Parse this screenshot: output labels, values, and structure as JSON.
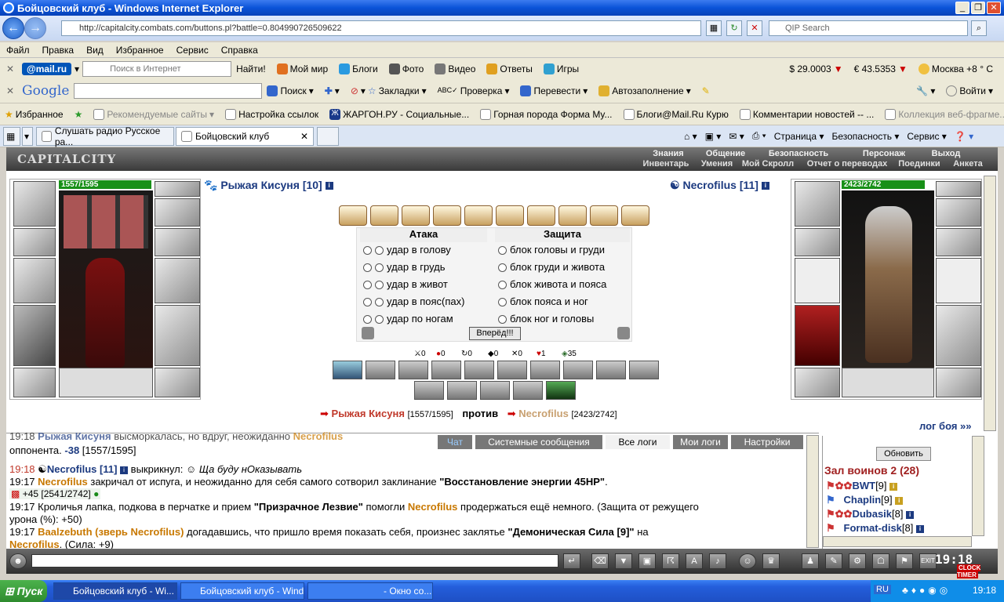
{
  "window": {
    "title": "Бойцовский клуб - Windows Internet Explorer"
  },
  "address": {
    "url": "http://capitalcity.combats.com/buttons.pl?battle=0.804990726509622",
    "search_placeholder": "QIP Search"
  },
  "menu": [
    "Файл",
    "Правка",
    "Вид",
    "Избранное",
    "Сервис",
    "Справка"
  ],
  "mailtb": {
    "logo": "@mail.ru",
    "search_placeholder": "Поиск в Интернет",
    "find": "Найти!",
    "items": [
      "Мой мир",
      "Блоги",
      "Фото",
      "Видео",
      "Ответы",
      "Игры"
    ],
    "usd": "$ 29.0003",
    "eur": "€ 43.5353",
    "weather": "Москва +8 ° С"
  },
  "googtb": {
    "logo": "Google",
    "items": [
      "Поиск",
      "Закладки",
      "Проверка",
      "Перевести",
      "Автозаполнение"
    ],
    "login": "Войти"
  },
  "favtb": {
    "fav": "Избранное",
    "items": [
      "Рекомендуемые сайты",
      "Настройка ссылок",
      "ЖАРГОН.РУ - Социальные...",
      "Горная порода Форма My...",
      "Блоги@Mail.Ru Курю",
      "Комментарии новостей -- ...",
      "Коллекция веб-фрагме..."
    ]
  },
  "tabs": [
    "Слушать радио Русское ра...",
    "Бойцовский клуб"
  ],
  "cmdbar": [
    "Страница",
    "Безопасность",
    "Сервис"
  ],
  "game": {
    "logo": "CAPITALCITY",
    "nav_top": [
      "Знания",
      "Общение",
      "Безопасность",
      "Персонаж",
      "Выход"
    ],
    "nav_bottom": [
      "Инвентарь",
      "Умения",
      "Мой Скролл",
      "Отчет о переводах",
      "Поединки",
      "Анкета"
    ],
    "player": {
      "name": "Рыжая Кисуня",
      "level": "[10]",
      "hp": "1557/1595",
      "hp_fraction": 0.976
    },
    "enemy": {
      "name": "Necrofilus",
      "level": "[11]",
      "hp": "2423/2742",
      "hp_fraction": 0.884
    },
    "attack_header": "Атака",
    "defense_header": "Защита",
    "attacks": [
      "удар в голову",
      "удар в грудь",
      "удар в живот",
      "удар в пояс(пах)",
      "удар по ногам"
    ],
    "blocks": [
      "блок головы и груди",
      "блок груди и живота",
      "блок живота и пояса",
      "блок пояса и ног",
      "блок ног и головы"
    ],
    "forward": "Вперёд!!!",
    "stats": [
      "0",
      "0",
      "0",
      "0",
      "0",
      "1",
      "35"
    ],
    "vs_left_name": "Рыжая Кисуня",
    "vs_left_hp": "[1557/1595]",
    "vs_word": "против",
    "vs_right_name": "Necrofilus",
    "vs_right_hp": "[2423/2742]",
    "log_link": "лог боя »»"
  },
  "chat": {
    "tabs": [
      "Чат",
      "Системные сообщения",
      "Все логи",
      "Мои логи",
      "Настройки"
    ],
    "lines": [
      {
        "time": "19:18",
        "who": "Рыжая Кисуня",
        "text": " высморкалась, но вдруг, неожиданно ",
        "who2": "Necrofilus"
      },
      {
        "time": "",
        "text": "оппонента. ",
        "dmg": "-38",
        "rest": " [1557/1595]"
      },
      {
        "time": "19:18",
        "who": "Necrofilus [11]",
        "text": " выкрикнул: ",
        "quote": "Ща буду нОказывать"
      },
      {
        "time": "19:17",
        "who": "Necrofilus",
        "text": " закричал от испуга, и неожиданно для себя самого сотворил заклинание ",
        "bold": "\"Восстановление энергии 45HP\"",
        "end": "."
      },
      {
        "time": "",
        "text": "+45 [2541/2742]"
      },
      {
        "time": "19:17",
        "text": "Кроличья лапка, подкова в перчатке и прием ",
        "bold": "\"Призрачное Лезвие\"",
        "text2": " помогли ",
        "who": "Necrofilus",
        "end": " продержаться ещё немного. (Защита от режущего"
      },
      {
        "time": "",
        "text": "урона (%): +50)"
      },
      {
        "time": "19:17",
        "who": "Baalzebuth (зверь Necrofilus)",
        "text": " догадавшись, что пришло время показать себя, произнес заклятье ",
        "bold": "\"Демоническая Сила [9]\"",
        "end": " на"
      },
      {
        "time": "",
        "who": "Necrofilus",
        "text": ". (Сила: +9)"
      }
    ]
  },
  "room": {
    "refresh": "Обновить",
    "title": "Зал воинов 2 (28)",
    "users": [
      {
        "name": "BWT",
        "lvl": "[9]"
      },
      {
        "name": "Chaplin",
        "lvl": "[9]"
      },
      {
        "name": "Dubasik",
        "lvl": "[8]"
      },
      {
        "name": "Format-disk",
        "lvl": "[8]"
      }
    ]
  },
  "clock": {
    "time": "19:18",
    "label": "CLOCK TIMER"
  },
  "taskbar": {
    "start": "Пуск",
    "tasks": [
      "Бойцовский клуб - Wi...",
      "Бойцовский клуб - Wind...",
      "- Окно со..."
    ],
    "lang": "RU",
    "time": "19:18"
  }
}
